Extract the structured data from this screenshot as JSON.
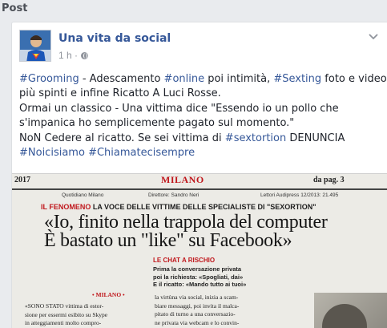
{
  "section_title": "Post",
  "post": {
    "page_name": "Una vita da social",
    "time": "1 h ·",
    "lines": [
      [
        {
          "t": "#Grooming",
          "tag": true
        },
        {
          "t": " - Adescamento "
        },
        {
          "t": "#online",
          "tag": true
        },
        {
          "t": " poi intimità, "
        },
        {
          "t": "#Sexting",
          "tag": true
        },
        {
          "t": " foto e video"
        }
      ],
      [
        {
          "t": "più spinti e infine Ricatto A Luci Rosse."
        }
      ],
      [
        {
          "t": "Ormai un classico - Una vittima dice \"Essendo io un pollo che"
        }
      ],
      [
        {
          "t": "s'impanica ho semplicemente pagato sul momento.\""
        }
      ],
      [
        {
          "t": "NoN Cedere al ricatto. Se sei vittima di "
        },
        {
          "t": "#sextortion",
          "tag": true
        },
        {
          "t": " DENUNCIA"
        }
      ],
      [
        {
          "t": "#Noicisiamo",
          "tag": true
        },
        {
          "t": " "
        },
        {
          "t": "#Chiamatecisempre",
          "tag": true
        }
      ]
    ]
  },
  "newspaper": {
    "year": "2017",
    "city": "MILANO",
    "page": "da pag. 3",
    "paper": "Quotidiano  Milano",
    "director": "Direttore:  Sandro Neri",
    "readers": "Lettori Audipress  12/2013:  21.495",
    "band_red": "IL FENOMENO",
    "band_text": " LA VOCE DELLE VITTIME DELLE SPECIALISTE DI \"SEXORTION\"",
    "headline_1": "«Io, finito nella trappola del computer",
    "headline_2": "È bastato un \"like\" su Facebook»",
    "kicker": "LE CHAT A RISCHIO",
    "sub_1": "Prima la conversazione privata",
    "sub_2": "poi la richiesta: «Spogliati, dai»",
    "sub_3": "E il ricatto: «Mando tutto ai tuoi»",
    "byline": "• MILANO •",
    "col1_1": "«SONO STATO vittima di estor-",
    "col1_2": "sione per essermi esibito su Skype",
    "col1_3": "in atteggiamenti molto compro-",
    "col2_1": "la virtùna via social, inizia a scam-",
    "col2_2": "biare messaggi, poi invita il malca-",
    "col2_3": "pitato di turno a una conversazio-",
    "col2_4": "ne privata via webcam e lo convin-"
  },
  "colors": {
    "link": "#365899",
    "text": "#1d2129",
    "meta": "#90949c",
    "np_red": "#c0171c"
  }
}
